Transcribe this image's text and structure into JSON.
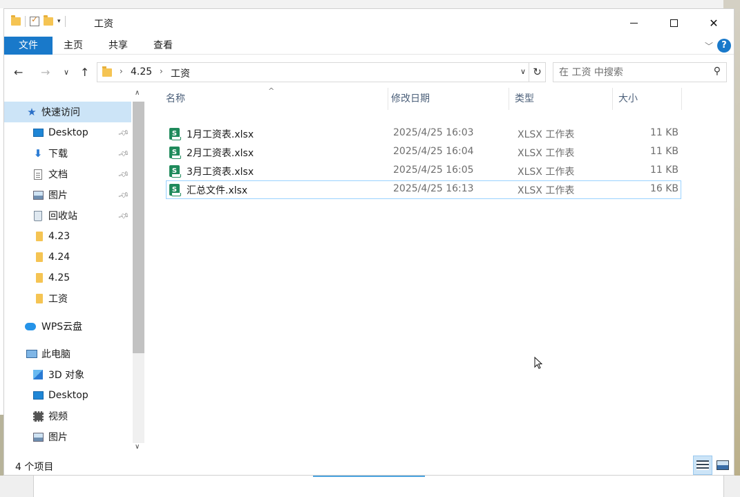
{
  "window": {
    "title": "工资",
    "quick_access_toolbar": [
      "folder-icon",
      "properties-icon",
      "new-folder-icon",
      "customize-dropdown-icon"
    ]
  },
  "ribbon": {
    "tabs": [
      {
        "label": "文件",
        "active": true
      },
      {
        "label": "主页"
      },
      {
        "label": "共享"
      },
      {
        "label": "查看"
      }
    ],
    "help_label": "?"
  },
  "address": {
    "crumbs": [
      "4.25",
      "工资"
    ],
    "refresh_icon": "↻"
  },
  "search": {
    "placeholder": "在 工资 中搜索"
  },
  "nav": {
    "items": [
      {
        "label": "快速访问",
        "icon": "star-icon",
        "selected": true
      },
      {
        "label": "Desktop",
        "icon": "desktop-icon",
        "pinned": true
      },
      {
        "label": "下载",
        "icon": "download-icon",
        "pinned": true
      },
      {
        "label": "文档",
        "icon": "document-icon",
        "pinned": true
      },
      {
        "label": "图片",
        "icon": "pictures-icon",
        "pinned": true
      },
      {
        "label": "回收站",
        "icon": "recycle-bin-icon",
        "pinned": true
      },
      {
        "label": "4.23",
        "icon": "folder-icon"
      },
      {
        "label": "4.24",
        "icon": "folder-icon"
      },
      {
        "label": "4.25",
        "icon": "folder-icon"
      },
      {
        "label": "工资",
        "icon": "folder-icon"
      },
      {
        "label": "WPS云盘",
        "icon": "cloud-icon"
      },
      {
        "label": "此电脑",
        "icon": "computer-icon"
      },
      {
        "label": "3D 对象",
        "icon": "3d-objects-icon"
      },
      {
        "label": "Desktop",
        "icon": "desktop-icon"
      },
      {
        "label": "视频",
        "icon": "video-icon"
      },
      {
        "label": "图片",
        "icon": "pictures-icon"
      }
    ]
  },
  "columns": {
    "name": "名称",
    "date": "修改日期",
    "type": "类型",
    "size": "大小"
  },
  "files": [
    {
      "name": "1月工资表.xlsx",
      "date": "2025/4/25 16:03",
      "type": "XLSX 工作表",
      "size": "11 KB",
      "icon_letter": "S"
    },
    {
      "name": "2月工资表.xlsx",
      "date": "2025/4/25 16:04",
      "type": "XLSX 工作表",
      "size": "11 KB",
      "icon_letter": "S"
    },
    {
      "name": "3月工资表.xlsx",
      "date": "2025/4/25 16:05",
      "type": "XLSX 工作表",
      "size": "11 KB",
      "icon_letter": "S"
    },
    {
      "name": "汇总文件.xlsx",
      "date": "2025/4/25 16:13",
      "type": "XLSX 工作表",
      "size": "16 KB",
      "icon_letter": "S",
      "hovered": true
    }
  ],
  "status": {
    "item_count": "4 个项目"
  },
  "colors": {
    "accent": "#1979ca",
    "selection": "#cce4f7",
    "hover_border": "#99d1ff",
    "folder": "#f5c453",
    "xlsx_icon": "#1f8a5b"
  }
}
